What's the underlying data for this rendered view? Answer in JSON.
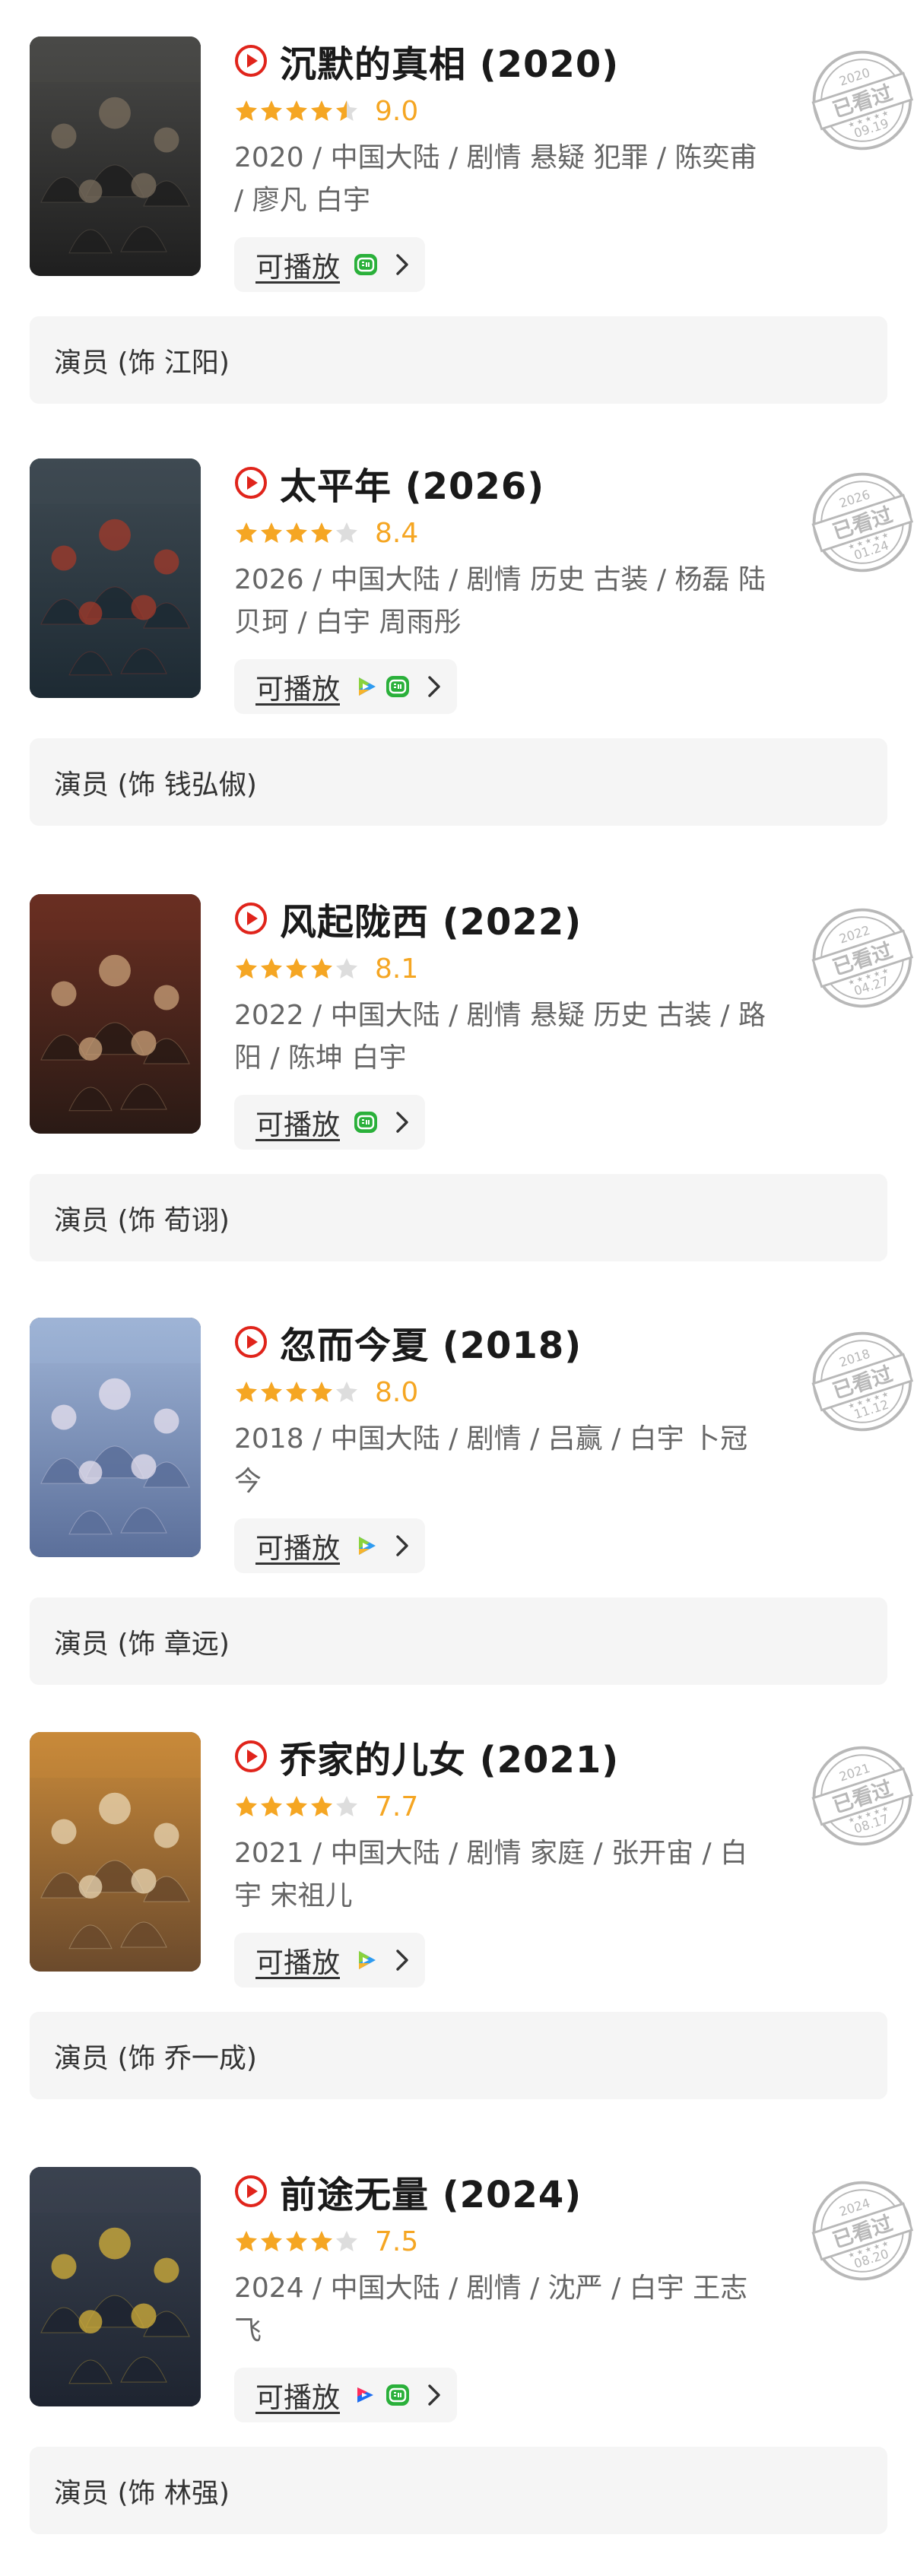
{
  "colors": {
    "accent_red": "#e0241b",
    "star_yellow": "#f5a623",
    "star_empty": "#dddddd",
    "card_bg": "#f5f5f5",
    "stamp_gray": "#b8b8b8"
  },
  "stamp": {
    "text": "已看过"
  },
  "entries": [
    {
      "title": "沉默的真相 (2020)",
      "rating": 9.0,
      "rating_text": "9.0",
      "stars": 4.5,
      "meta": "2020 / 中国大陆 / 剧情 悬疑 犯罪 / 陈奕甫 / 廖凡 白宇",
      "play_label": "可播放",
      "sources": [
        "iqiyi-icon"
      ],
      "stamp_year": "2020",
      "stamp_date": "09.19",
      "role": "演员 (饰 江阳)",
      "poster_colors": [
        "#4a4a48",
        "#1f1f1f",
        "#7a6e5e"
      ]
    },
    {
      "title": "太平年 (2026)",
      "rating": 8.4,
      "rating_text": "8.4",
      "stars": 4,
      "meta": "2026 / 中国大陆 / 剧情 历史 古装 / 杨磊 陆贝珂 / 白宇 周雨彤",
      "play_label": "可播放",
      "sources": [
        "tencent-video-icon",
        "iqiyi-icon"
      ],
      "stamp_year": "2026",
      "stamp_date": "01.24",
      "role": "演员 (饰 钱弘俶)",
      "poster_colors": [
        "#3f4a52",
        "#1d2a33",
        "#a33a2a"
      ]
    },
    {
      "title": "风起陇西 (2022)",
      "rating": 8.1,
      "rating_text": "8.1",
      "stars": 4,
      "meta": "2022 / 中国大陆 / 剧情 悬疑 历史 古装 / 路阳 / 陈坤 白宇",
      "play_label": "可播放",
      "sources": [
        "iqiyi-icon"
      ],
      "stamp_year": "2022",
      "stamp_date": "04.27",
      "role": "演员 (饰 荀诩)",
      "poster_colors": [
        "#6a2f22",
        "#2a1a15",
        "#c9a27a"
      ]
    },
    {
      "title": "忽而今夏 (2018)",
      "rating": 8.0,
      "rating_text": "8.0",
      "stars": 4,
      "meta": "2018 / 中国大陆 / 剧情 / 吕赢 / 白宇 卜冠今",
      "play_label": "可播放",
      "sources": [
        "tencent-video-icon"
      ],
      "stamp_year": "2018",
      "stamp_date": "11.12",
      "role": "演员 (饰 章远)",
      "poster_colors": [
        "#9fb4d6",
        "#5b6f9a",
        "#e8e2ef"
      ]
    },
    {
      "title": "乔家的儿女 (2021)",
      "rating": 7.7,
      "rating_text": "7.7",
      "stars": 4,
      "meta": "2021 / 中国大陆 / 剧情 家庭 / 张开宙 / 白宇 宋祖儿",
      "play_label": "可播放",
      "sources": [
        "tencent-video-icon"
      ],
      "stamp_year": "2021",
      "stamp_date": "08.17",
      "role": "演员 (饰 乔一成)",
      "poster_colors": [
        "#c98a3a",
        "#6b4a2c",
        "#e9d7b4"
      ]
    },
    {
      "title": "前途无量 (2024)",
      "rating": 7.5,
      "rating_text": "7.5",
      "stars": 4,
      "meta": "2024 / 中国大陆 / 剧情 / 沈严 / 白宇 王志飞",
      "play_label": "可播放",
      "sources": [
        "youku-icon",
        "iqiyi-icon"
      ],
      "stamp_year": "2024",
      "stamp_date": "08.20",
      "role": "演员 (饰 林强)",
      "poster_colors": [
        "#3b4350",
        "#1e2430",
        "#d6b13a"
      ]
    }
  ]
}
